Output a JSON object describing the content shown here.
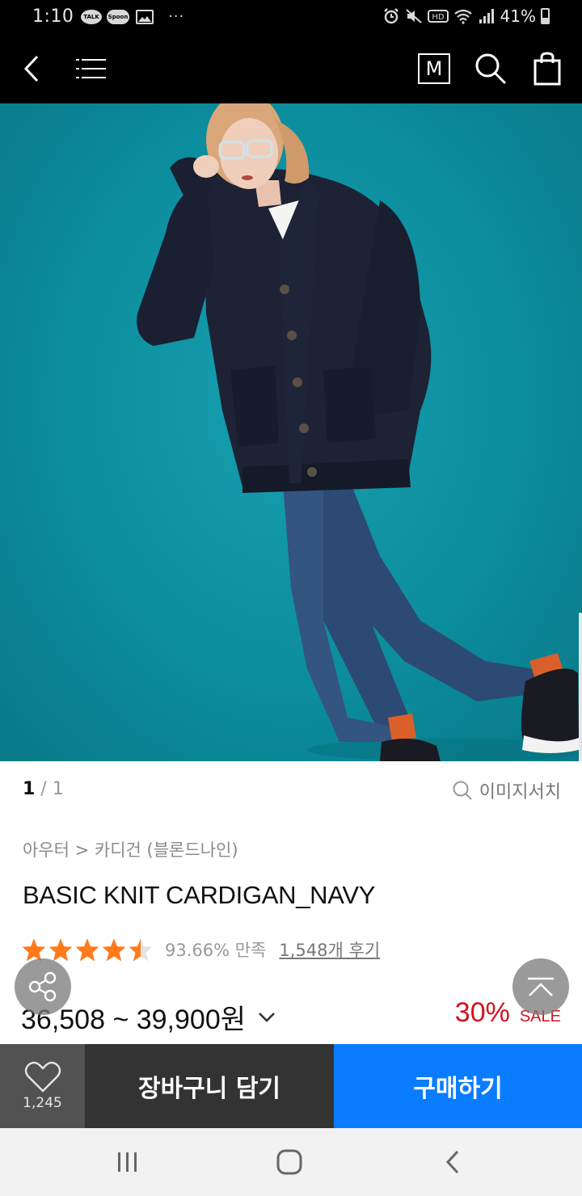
{
  "status_bar": {
    "time": "1:10",
    "notifications": [
      "TALK",
      "Spoon"
    ],
    "more": "···",
    "battery": "41%"
  },
  "header": {
    "back_icon": "chevron-left-icon",
    "menu_icon": "list-menu-icon",
    "m_label": "M",
    "search_icon": "search-icon",
    "bag_icon": "shopping-bag-icon"
  },
  "gallery": {
    "current": "1",
    "separator": " / ",
    "total": "1",
    "image_search_label": "이미지서치"
  },
  "product": {
    "breadcrumb": "아우터 > 카디건 (블론드나인)",
    "title": "BASIC KNIT CARDIGAN_NAVY",
    "rating_stars": 4.5,
    "satisfaction": "93.66% 만족",
    "reviews": "1,548개 후기",
    "price": "36,508 ~ 39,900원",
    "discount": "30%",
    "sale_label": "SALE"
  },
  "actions": {
    "wish_count": "1,245",
    "cart_label": "장바구니 담기",
    "buy_label": "구매하기"
  },
  "colors": {
    "accent_blue": "#0a7cff",
    "sale_red": "#d0141e",
    "star_orange": "#ff7a1a",
    "hero_teal": "#0c8d9d"
  }
}
